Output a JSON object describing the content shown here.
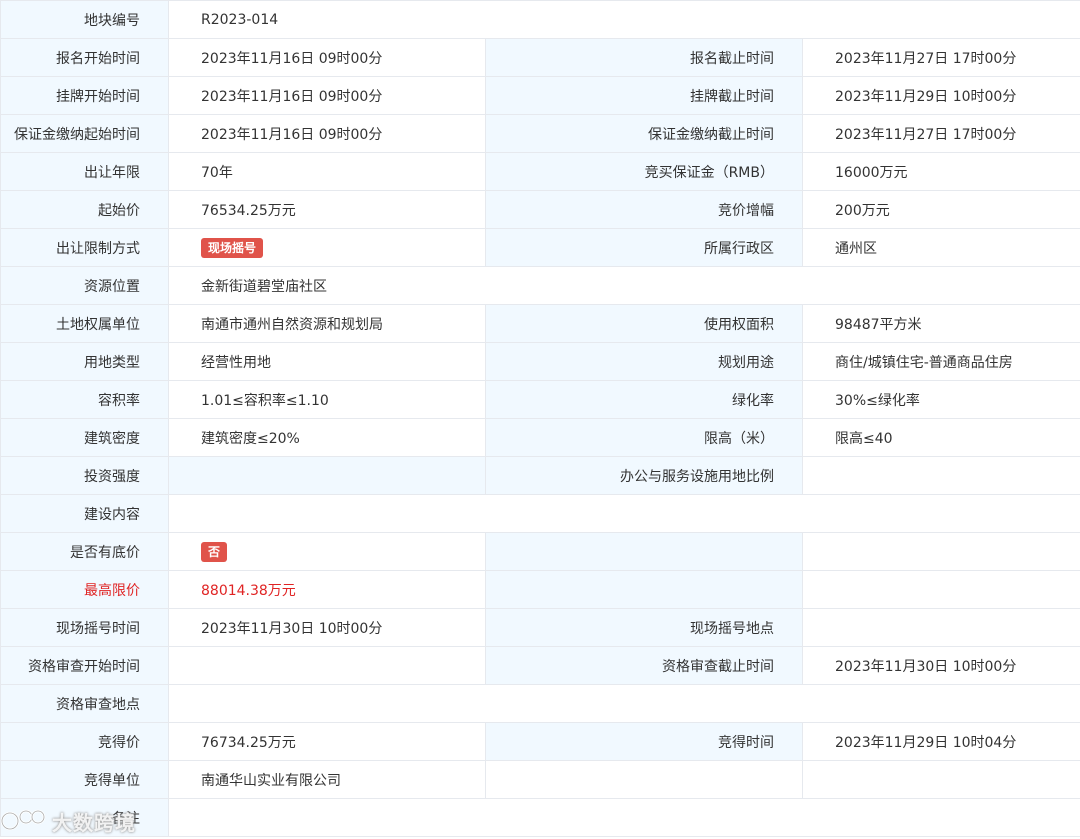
{
  "rows": [
    {
      "k1": "地块编号",
      "v1": "R2023-014"
    },
    {
      "k1": "报名开始时间",
      "v1": "2023年11月16日 09时00分",
      "k2": "报名截止时间",
      "v2": "2023年11月27日 17时00分"
    },
    {
      "k1": "挂牌开始时间",
      "v1": "2023年11月16日 09时00分",
      "k2": "挂牌截止时间",
      "v2": "2023年11月29日 10时00分"
    },
    {
      "k1": "保证金缴纳起始时间",
      "v1": "2023年11月16日 09时00分",
      "k2": "保证金缴纳截止时间",
      "v2": "2023年11月27日 17时00分"
    },
    {
      "k1": "出让年限",
      "v1": "70年",
      "k2": "竞买保证金（RMB）",
      "v2": "16000万元"
    },
    {
      "k1": "起始价",
      "v1": "76534.25万元",
      "k2": "竞价增幅",
      "v2": "200万元"
    },
    {
      "k1": "出让限制方式",
      "badge1": "现场摇号",
      "k2": "所属行政区",
      "v2": "通州区"
    },
    {
      "k1": "资源位置",
      "v1": "金新街道碧堂庙社区"
    },
    {
      "k1": "土地权属单位",
      "v1": "南通市通州自然资源和规划局",
      "k2": "使用权面积",
      "v2": "98487平方米"
    },
    {
      "k1": "用地类型",
      "v1": "经营性用地",
      "k2": "规划用途",
      "v2": "商住/城镇住宅-普通商品住房"
    },
    {
      "k1": "容积率",
      "v1": "1.01≤容积率≤1.10",
      "k2": "绿化率",
      "v2": "30%≤绿化率"
    },
    {
      "k1": "建筑密度",
      "v1": "建筑密度≤20%",
      "k2": "限高（米）",
      "v2": "限高≤40"
    },
    {
      "k1": "投资强度",
      "v1": "",
      "k2": "办公与服务设施用地比例",
      "v2": ""
    },
    {
      "k1": "建设内容",
      "v1": ""
    },
    {
      "k1": "是否有底价",
      "badge1": "否",
      "k2": "",
      "v2": ""
    },
    {
      "k1": "最高限价",
      "v1": "88014.38万元",
      "k2": "",
      "v2": ""
    },
    {
      "k1": "现场摇号时间",
      "v1": "2023年11月30日 10时00分",
      "k2": "现场摇号地点",
      "v2": ""
    },
    {
      "k1": "资格审查开始时间",
      "v1": "",
      "k2": "资格审查截止时间",
      "v2": "2023年11月30日 10时00分"
    },
    {
      "k1": "资格审查地点",
      "v1": ""
    },
    {
      "k1": "竞得价",
      "v1": "76734.25万元",
      "k2": "竞得时间",
      "v2": "2023年11月29日 10时04分"
    },
    {
      "k1": "竞得单位",
      "v1": "南通华山实业有限公司",
      "k2": "",
      "v2": ""
    },
    {
      "k1": "备注",
      "v1": ""
    }
  ],
  "watermark": {
    "text": "大数跨境"
  },
  "colors": {
    "label_bg": "#f1f9ff",
    "border": "#e6e9ee",
    "badge": "#e0534a",
    "highlight": "#e02424"
  }
}
